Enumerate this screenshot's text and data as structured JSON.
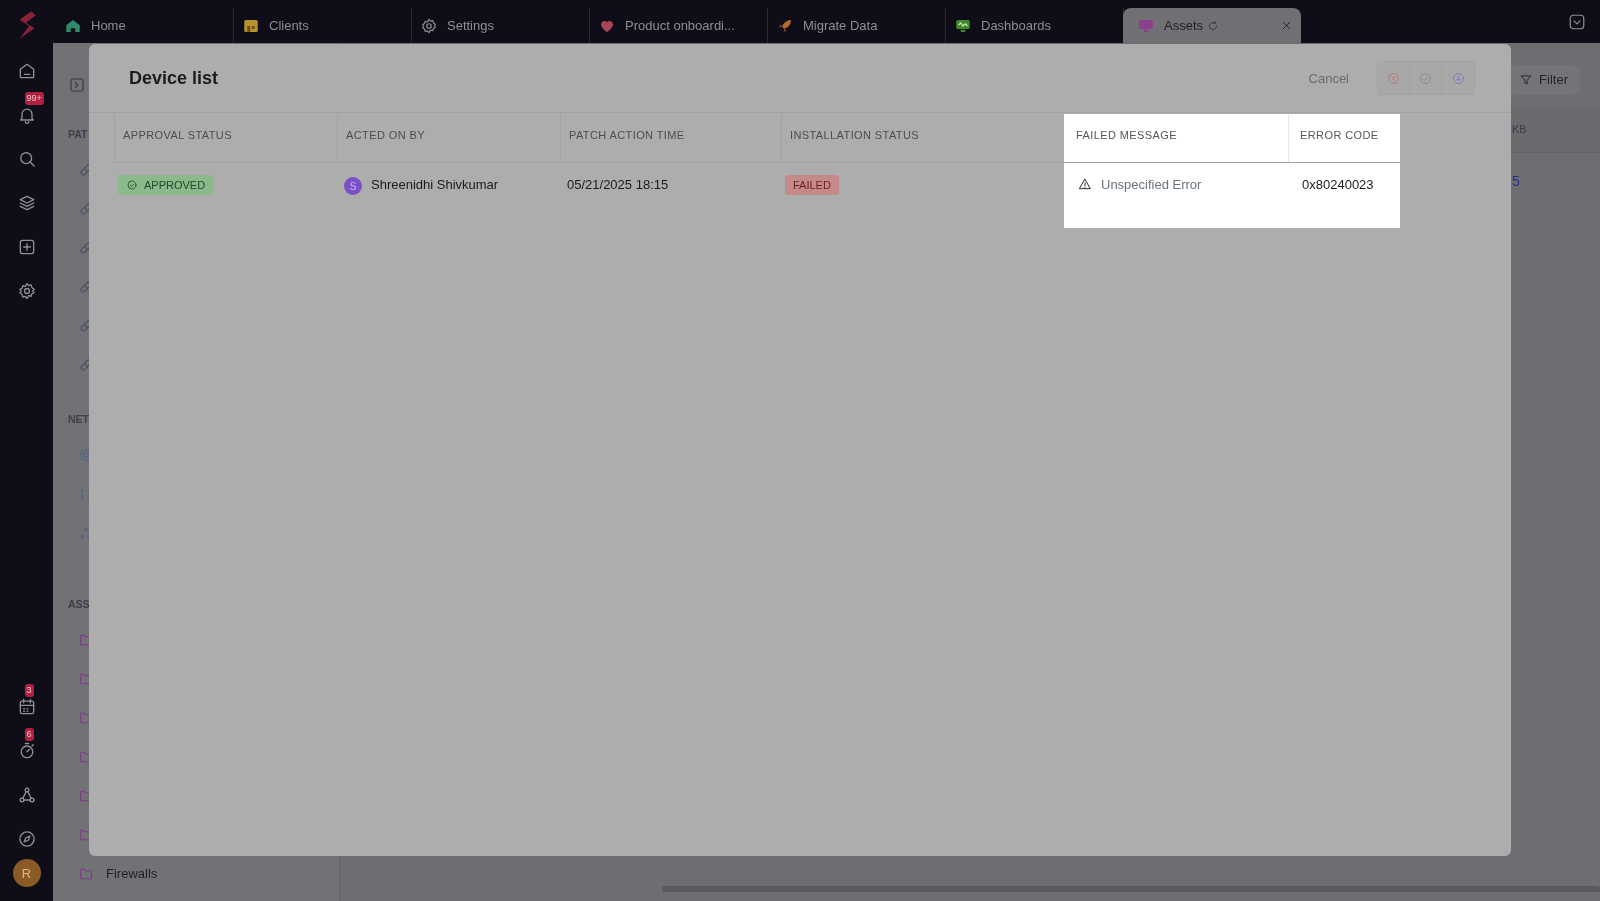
{
  "rail": {
    "top_items": [
      {
        "kind": "home"
      },
      {
        "kind": "bell",
        "badge": "99+"
      },
      {
        "kind": "search"
      },
      {
        "kind": "layers"
      },
      {
        "kind": "plus"
      },
      {
        "kind": "settings"
      }
    ],
    "bottom_items": [
      {
        "kind": "calendar",
        "badge": "3"
      },
      {
        "kind": "timer",
        "badge": "6"
      },
      {
        "kind": "network"
      },
      {
        "kind": "compass"
      }
    ],
    "avatar": {
      "initial": "R"
    }
  },
  "tabs": [
    {
      "label": "Home",
      "kind": "home",
      "selected": false
    },
    {
      "label": "Clients",
      "kind": "store",
      "selected": false
    },
    {
      "label": "Settings",
      "kind": "settings",
      "selected": false
    },
    {
      "label": "Product onboardi...",
      "kind": "heart",
      "selected": false
    },
    {
      "label": "Migrate Data",
      "kind": "rocket",
      "selected": false
    },
    {
      "label": "Dashboards",
      "kind": "monitor",
      "selected": false
    },
    {
      "label": "Assets",
      "kind": "screen",
      "selected": true,
      "loading": true
    }
  ],
  "background": {
    "sections": [
      {
        "label": "PAT",
        "items": [
          {
            "kind": "pill"
          },
          {
            "kind": "pill"
          },
          {
            "kind": "pill"
          },
          {
            "kind": "pill"
          },
          {
            "kind": "pill"
          },
          {
            "kind": "pill"
          }
        ]
      },
      {
        "label": "NET",
        "items": [
          {
            "kind": "globe"
          },
          {
            "kind": "link"
          },
          {
            "kind": "share"
          }
        ]
      },
      {
        "label": "ASS",
        "items": [
          {
            "kind": "folder"
          },
          {
            "kind": "folder"
          },
          {
            "kind": "folder"
          },
          {
            "kind": "folder"
          },
          {
            "kind": "folder"
          },
          {
            "kind": "folder"
          },
          {
            "kind": "folder",
            "label": "Firewalls"
          }
        ]
      }
    ],
    "filter_button": "Filter",
    "column_header": "KB",
    "cell": "5"
  },
  "modal": {
    "title": "Device list",
    "cancel": "Cancel",
    "actions": [
      {
        "kind": "reject"
      },
      {
        "kind": "approve"
      },
      {
        "kind": "download"
      }
    ],
    "columns": [
      {
        "label": "APPROVAL STATUS",
        "highlighted": false
      },
      {
        "label": "ACTED ON BY",
        "highlighted": false
      },
      {
        "label": "PATCH ACTION TIME",
        "highlighted": false
      },
      {
        "label": "INSTALLATION STATUS",
        "highlighted": false
      },
      {
        "label": "FAILED MESSAGE",
        "highlighted": true
      },
      {
        "label": "ERROR CODE",
        "highlighted": true
      }
    ],
    "rows": [
      {
        "approval": {
          "text": "APPROVED",
          "kind": "success"
        },
        "acted_by": {
          "initial": "S",
          "name": "Shreenidhi Shivkumar"
        },
        "time": "05/21/2025 18:15",
        "installation": {
          "text": "FAILED",
          "kind": "danger"
        },
        "failed_message": "Unspecified Error",
        "error_code": "0x80240023"
      }
    ]
  }
}
